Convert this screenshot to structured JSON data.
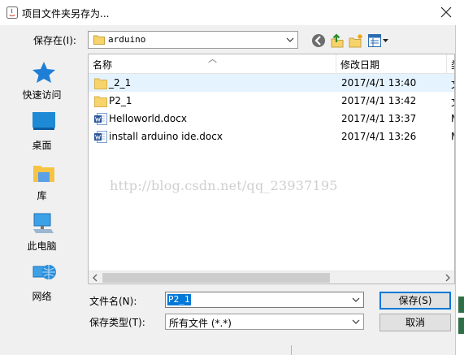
{
  "window": {
    "title": "项目文件夹另存为..."
  },
  "toolbar": {
    "save_in_label": "保存在(I):",
    "save_in_value": "arduino",
    "icons": [
      "back-icon",
      "up-folder-icon",
      "new-folder-icon",
      "view-menu-icon"
    ]
  },
  "places": [
    {
      "label": "快速访问",
      "icon": "star-icon"
    },
    {
      "label": "桌面",
      "icon": "desktop-icon"
    },
    {
      "label": "库",
      "icon": "library-icon"
    },
    {
      "label": "此电脑",
      "icon": "computer-icon"
    },
    {
      "label": "网络",
      "icon": "network-icon"
    }
  ],
  "columns": {
    "name": "名称",
    "date": "修改日期",
    "type": "类"
  },
  "files": [
    {
      "name": "_2_1",
      "date": "2017/4/1 13:40",
      "type": "文",
      "icon": "folder-icon",
      "selected": true
    },
    {
      "name": "P2_1",
      "date": "2017/4/1 13:42",
      "type": "文",
      "icon": "folder-icon",
      "selected": false
    },
    {
      "name": "Helloworld.docx",
      "date": "2017/4/1 13:37",
      "type": "M",
      "icon": "word-doc-icon",
      "selected": false
    },
    {
      "name": "install arduino ide.docx",
      "date": "2017/4/1 13:26",
      "type": "M",
      "icon": "word-doc-icon",
      "selected": false
    }
  ],
  "watermark": "http://blog.csdn.net/qq_23937195",
  "form": {
    "filename_label": "文件名(N):",
    "filename_value": "P2_1",
    "filetype_label": "保存类型(T):",
    "filetype_value": "所有文件 (*.*)"
  },
  "buttons": {
    "save": "保存(S)",
    "cancel": "取消"
  },
  "colors": {
    "accent": "#0078d7",
    "selection": "#e5f3ff",
    "folder": "#f7d36b"
  }
}
